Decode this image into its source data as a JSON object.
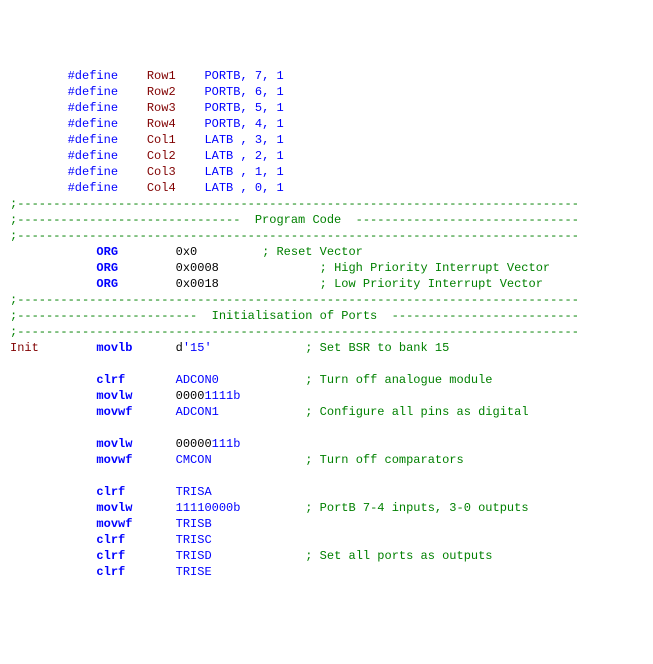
{
  "defines": [
    {
      "name": "Row1",
      "reg": "PORTB",
      "bit": "7",
      "val": "1"
    },
    {
      "name": "Row2",
      "reg": "PORTB",
      "bit": "6",
      "val": "1"
    },
    {
      "name": "Row3",
      "reg": "PORTB",
      "bit": "5",
      "val": "1"
    },
    {
      "name": "Row4",
      "reg": "PORTB",
      "bit": "4",
      "val": "1"
    },
    {
      "name": "Col1",
      "reg": "LATB",
      "bit": "3",
      "val": "1"
    },
    {
      "name": "Col2",
      "reg": "LATB",
      "bit": "2",
      "val": "1"
    },
    {
      "name": "Col3",
      "reg": "LATB",
      "bit": "1",
      "val": "1"
    },
    {
      "name": "Col4",
      "reg": "LATB",
      "bit": "0",
      "val": "1"
    }
  ],
  "separators": {
    "sep_full": ";------------------------------------------------------------------------------",
    "sep_program": ";-------------------------------  Program Code  -------------------------------",
    "sep_init": ";-------------------------  Initialisation of Ports  --------------------------"
  },
  "org_lines": [
    {
      "op": "ORG",
      "addr": "0x0",
      "comment": "; Reset Vector",
      "addr_pad": "0x0      ",
      "gap": "   "
    },
    {
      "op": "ORG",
      "addr": "0x0008",
      "comment": "; High Priority Interrupt Vector",
      "addr_pad": "0x0008           ",
      "gap": "   "
    },
    {
      "op": "ORG",
      "addr": "0x0018",
      "comment": "; Low Priority Interrupt Vector",
      "addr_pad": "0x0018           ",
      "gap": "   "
    }
  ],
  "init_label": "Init",
  "init_block": [
    {
      "type": "instr",
      "label": "Init",
      "mnemonic": "movlb",
      "operand": "d'15'",
      "comment": "; Set BSR to bank 15",
      "op_pad": "d'15'           "
    },
    {
      "type": "blank"
    },
    {
      "type": "instr",
      "mnemonic": "clrf",
      "operand": "ADCON0",
      "comment": "; Turn off analogue module",
      "op_pad": "ADCON0          "
    },
    {
      "type": "instr",
      "mnemonic": "movlw",
      "operand": "00001111b",
      "comment": "",
      "op_pad": "00001111b"
    },
    {
      "type": "instr",
      "mnemonic": "movwf",
      "operand": "ADCON1",
      "comment": "; Configure all pins as digital",
      "op_pad": "ADCON1          "
    },
    {
      "type": "blank"
    },
    {
      "type": "instr",
      "mnemonic": "movlw",
      "operand": "00000111b",
      "comment": "",
      "op_pad": "00000111b"
    },
    {
      "type": "instr",
      "mnemonic": "movwf",
      "operand": "CMCON",
      "comment": "; Turn off comparators",
      "op_pad": "CMCON           "
    },
    {
      "type": "blank"
    },
    {
      "type": "instr",
      "mnemonic": "clrf",
      "operand": "TRISA",
      "comment": "",
      "op_pad": "TRISA"
    },
    {
      "type": "instr",
      "mnemonic": "movlw",
      "operand": "11110000b",
      "comment": "; PortB 7-4 inputs, 3-0 outputs",
      "op_pad": "11110000b       "
    },
    {
      "type": "instr",
      "mnemonic": "movwf",
      "operand": "TRISB",
      "comment": "",
      "op_pad": "TRISB"
    },
    {
      "type": "instr",
      "mnemonic": "clrf",
      "operand": "TRISC",
      "comment": "",
      "op_pad": "TRISC"
    },
    {
      "type": "instr",
      "mnemonic": "clrf",
      "operand": "TRISD",
      "comment": "; Set all ports as outputs",
      "op_pad": "TRISD           "
    },
    {
      "type": "instr",
      "mnemonic": "clrf",
      "operand": "TRISE",
      "comment": "",
      "op_pad": "TRISE"
    }
  ],
  "layout": {
    "define_indent": "        ",
    "directive": "#define",
    "define_gap1": "    ",
    "define_name_width": 8,
    "define_reg_width": 5,
    "org_indent": "            ",
    "org_gap": "        ",
    "instr_indent": "            ",
    "mnemonic_width": 8,
    "define_sep": ", "
  }
}
